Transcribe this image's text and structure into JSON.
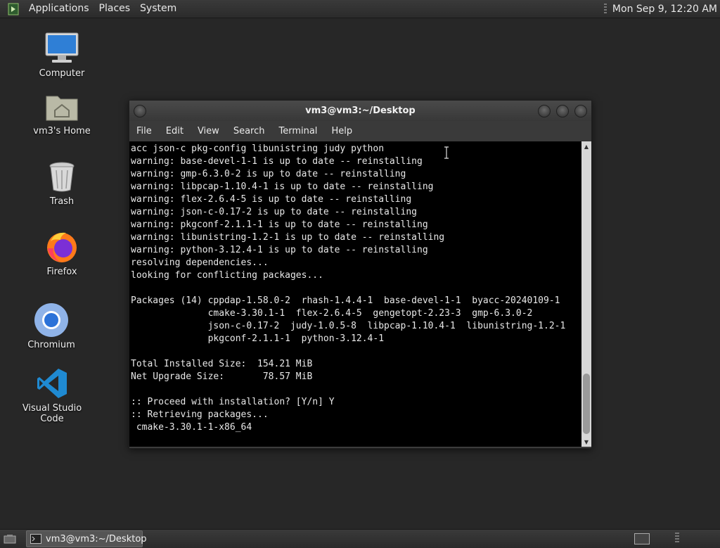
{
  "top_panel": {
    "menus": [
      "Applications",
      "Places",
      "System"
    ],
    "clock": "Mon Sep  9, 12:20 AM"
  },
  "desktop_icons": [
    {
      "label": "Computer",
      "icon": "computer-icon"
    },
    {
      "label": "vm3's Home",
      "icon": "home-folder-icon"
    },
    {
      "label": "Trash",
      "icon": "trash-icon"
    },
    {
      "label": "Firefox",
      "icon": "firefox-icon"
    },
    {
      "label": "Chromium",
      "icon": "chromium-icon"
    },
    {
      "label": "Visual Studio Code",
      "icon": "vscode-icon"
    }
  ],
  "terminal": {
    "title": "vm3@vm3:~/Desktop",
    "menu": [
      "File",
      "Edit",
      "View",
      "Search",
      "Terminal",
      "Help"
    ],
    "output": "acc json-c pkg-config libunistring judy python\nwarning: base-devel-1-1 is up to date -- reinstalling\nwarning: gmp-6.3.0-2 is up to date -- reinstalling\nwarning: libpcap-1.10.4-1 is up to date -- reinstalling\nwarning: flex-2.6.4-5 is up to date -- reinstalling\nwarning: json-c-0.17-2 is up to date -- reinstalling\nwarning: pkgconf-2.1.1-1 is up to date -- reinstalling\nwarning: libunistring-1.2-1 is up to date -- reinstalling\nwarning: python-3.12.4-1 is up to date -- reinstalling\nresolving dependencies...\nlooking for conflicting packages...\n\nPackages (14) cppdap-1.58.0-2  rhash-1.4.4-1  base-devel-1-1  byacc-20240109-1\n              cmake-3.30.1-1  flex-2.6.4-5  gengetopt-2.23-3  gmp-6.3.0-2\n              json-c-0.17-2  judy-1.0.5-8  libpcap-1.10.4-1  libunistring-1.2-1\n              pkgconf-2.1.1-1  python-3.12.4-1\n\nTotal Installed Size:  154.21 MiB\nNet Upgrade Size:       78.57 MiB\n\n:: Proceed with installation? [Y/n] Y\n:: Retrieving packages...\n cmake-3.30.1-1-x86_64"
  },
  "bottom_panel": {
    "task_title": "vm3@vm3:~/Desktop"
  }
}
